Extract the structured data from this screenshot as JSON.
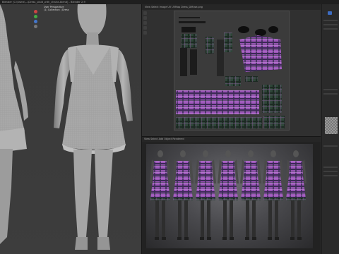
{
  "window": {
    "title": "Blender [C:\\Users\\...\\Dress_plaid_with_chains.blend] - Blender 2.9"
  },
  "viewport_left": {
    "object_info": "User Perspective\n(1) Collection | Dress"
  },
  "uv_editor": {
    "header": "View  Select  Image  UV    UVMap    Dress_Diffuse.png"
  },
  "render_view": {
    "header": "View  Select  Add  Object    Rendered"
  },
  "colors": {
    "plaid_purple": "#a35bc0",
    "plaid_green": "#2f4a3c",
    "clay": "#a9a9a9",
    "accent_blue": "#3d6cc1"
  },
  "icons": [
    "move-icon",
    "rotate-icon",
    "scale-icon",
    "grid-icon"
  ]
}
